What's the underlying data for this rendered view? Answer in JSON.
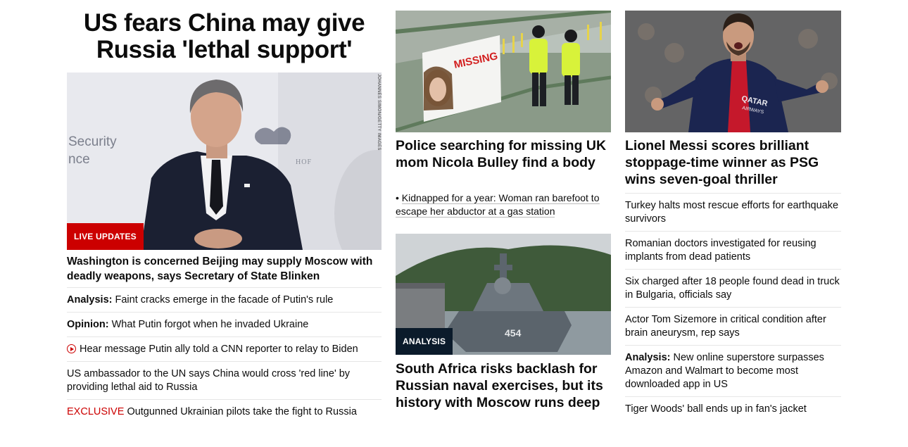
{
  "col1": {
    "main_headline": "US fears China may give Russia 'lethal support'",
    "hero_badge": "LIVE UPDATES",
    "hero_credit": "JOHANNES SIMON/GETTY IMAGES",
    "hero_backdrop_text_1": "Security",
    "hero_backdrop_text_2": "nce",
    "hero_backdrop_text_3": "HOF",
    "sub_headline": "Washington is concerned Beijing may supply Moscow with deadly weapons, says Secretary of State Blinken",
    "items": [
      {
        "kicker": "Analysis:",
        "text": "Faint cracks emerge in the facade of Putin's rule"
      },
      {
        "kicker": "Opinion:",
        "text": "What Putin forgot when he invaded Ukraine"
      },
      {
        "icon": "play-icon",
        "text": "Hear message Putin ally told a CNN reporter to relay to Biden"
      },
      {
        "text": "US ambassador to the UN says China would cross 'red line' by providing lethal aid to Russia"
      },
      {
        "kicker_red": "EXCLUSIVE",
        "text": "Outgunned Ukrainian pilots take the fight to Russia"
      }
    ]
  },
  "col2": {
    "card1": {
      "image_sign": "MISSING",
      "title": "Police searching for missing UK mom Nicola Bulley find a body",
      "related": "Kidnapped for a year: Woman ran barefoot to escape her abductor at a gas station"
    },
    "card2": {
      "badge": "ANALYSIS",
      "hull_number": "454",
      "title": "South Africa risks backlash for Russian naval exercises, but its history with Moscow runs deep"
    }
  },
  "col3": {
    "card": {
      "shirt_text_1": "QATAR",
      "shirt_text_2": "AIRWAYS",
      "title": "Lionel Messi scores brilliant stoppage-time winner as PSG wins seven-goal thriller"
    },
    "items": [
      {
        "text": "Turkey halts most rescue efforts for earthquake survivors"
      },
      {
        "text": "Romanian doctors investigated for reusing implants from dead patients"
      },
      {
        "text": "Six charged after 18 people found dead in truck in Bulgaria, officials say"
      },
      {
        "text": "Actor Tom Sizemore in critical condition after brain aneurysm, rep says"
      },
      {
        "kicker": "Analysis:",
        "text": "New online superstore surpasses Amazon and Walmart to become most downloaded app in US"
      },
      {
        "text": "Tiger Woods' ball ends up in fan's jacket"
      }
    ]
  },
  "colors": {
    "brand_red": "#cc0000",
    "badge_navy": "#0b1b2b",
    "divider": "#e6e6e6"
  }
}
